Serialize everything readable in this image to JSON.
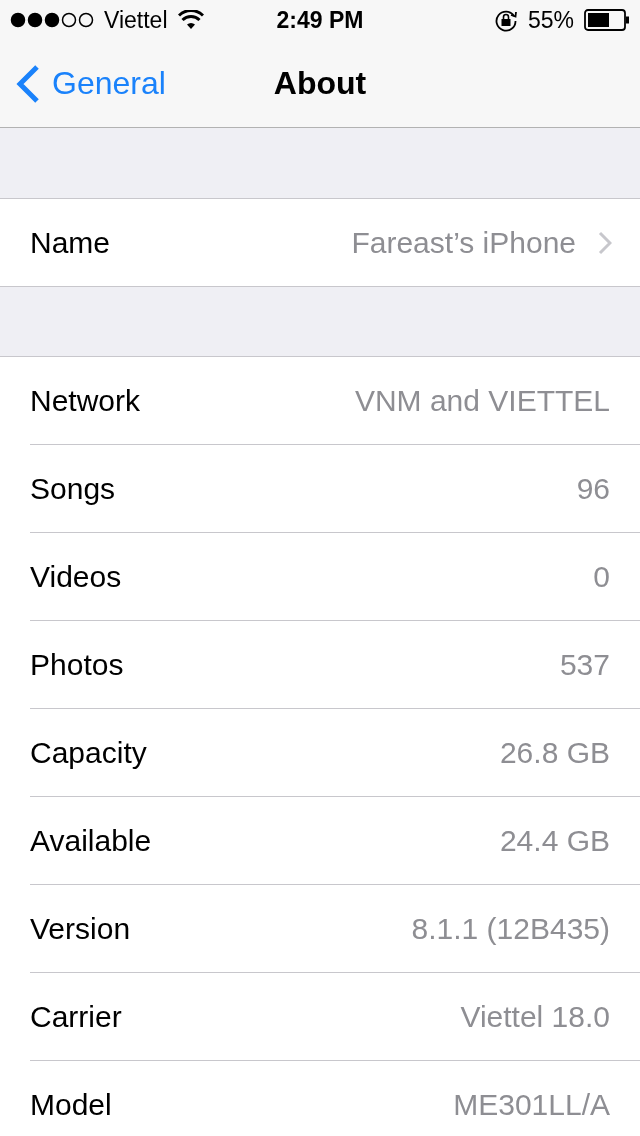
{
  "status_bar": {
    "carrier": "Viettel",
    "time": "2:49 PM",
    "battery": "55%"
  },
  "nav": {
    "back": "General",
    "title": "About"
  },
  "name_row": {
    "label": "Name",
    "value": "Fareast’s iPhone"
  },
  "rows": [
    {
      "label": "Network",
      "value": "VNM and VIETTEL"
    },
    {
      "label": "Songs",
      "value": "96"
    },
    {
      "label": "Videos",
      "value": "0"
    },
    {
      "label": "Photos",
      "value": "537"
    },
    {
      "label": "Capacity",
      "value": "26.8 GB"
    },
    {
      "label": "Available",
      "value": "24.4 GB"
    },
    {
      "label": "Version",
      "value": "8.1.1 (12B435)"
    },
    {
      "label": "Carrier",
      "value": "Viettel 18.0"
    },
    {
      "label": "Model",
      "value": "ME301LL/A"
    }
  ]
}
